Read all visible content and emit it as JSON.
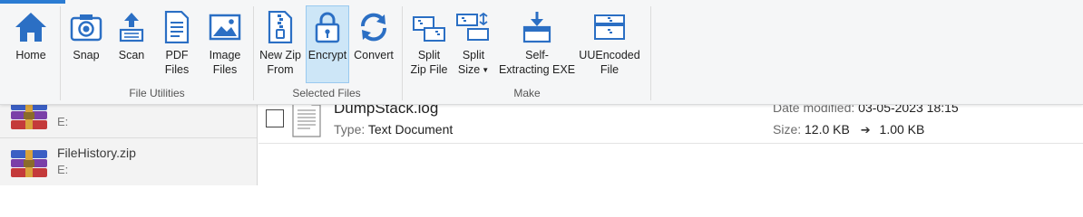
{
  "ribbon": {
    "groups": [
      {
        "label": "",
        "buttons": [
          {
            "label": "Home"
          }
        ]
      },
      {
        "label": "File Utilities",
        "buttons": [
          {
            "label": "Snap"
          },
          {
            "label": "Scan"
          },
          {
            "label": "PDF\nFiles"
          },
          {
            "label": "Image\nFiles"
          }
        ]
      },
      {
        "label": "Selected Files",
        "buttons": [
          {
            "label": "New Zip\nFrom"
          },
          {
            "label": "Encrypt"
          },
          {
            "label": "Convert"
          }
        ]
      },
      {
        "label": "Make",
        "buttons": [
          {
            "label": "Split\nZip File"
          },
          {
            "label": "Split\nSize"
          },
          {
            "label": "Self-\nExtracting EXE"
          },
          {
            "label": "UUEncoded\nFile"
          }
        ]
      }
    ],
    "active_button": "Encrypt",
    "accent_color": "#2b7cd3"
  },
  "left_list": {
    "items": [
      {
        "name": "",
        "drive": "E:"
      },
      {
        "name": "FileHistory.zip",
        "drive": "E:"
      }
    ]
  },
  "file_row": {
    "name": "DumpStack.log",
    "type_label": "Type:",
    "type_value": "Text Document",
    "modified_label": "Date modified:",
    "modified_value": "03-05-2023 18:15",
    "size_label": "Size:",
    "size_from": "12.0 KB",
    "size_to": "1.00 KB"
  }
}
